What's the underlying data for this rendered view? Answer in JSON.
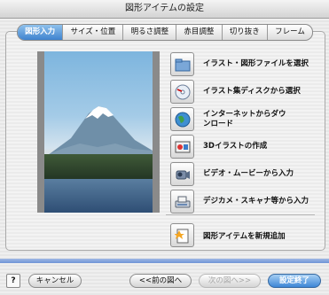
{
  "window": {
    "title": "図形アイテムの設定"
  },
  "tabs": [
    {
      "label": "図形入力"
    },
    {
      "label": "サイズ・位置"
    },
    {
      "label": "明るさ調整"
    },
    {
      "label": "赤目調整"
    },
    {
      "label": "切り抜き"
    },
    {
      "label": "フレーム"
    }
  ],
  "actions": [
    {
      "label": "イラスト・図形ファイルを選択",
      "icon": "folder-icon"
    },
    {
      "label": "イラスト集ディスクから選択",
      "icon": "disc-icon"
    },
    {
      "label_line1": "インターネットからダウ",
      "label_line2": "ンロード",
      "icon": "globe-icon"
    },
    {
      "label": "3Dイラストの作成",
      "icon": "3d-illustration-icon"
    },
    {
      "label": "ビデオ・ムービーから入力",
      "icon": "video-camera-icon"
    },
    {
      "label": "デジカメ・スキャナ等から入力",
      "icon": "scanner-icon"
    }
  ],
  "add_item": {
    "label": "図形アイテムを新規追加",
    "icon": "new-document-icon"
  },
  "footer": {
    "help": "?",
    "cancel": "キャンセル",
    "prev": "<<前の図へ",
    "next": "次の図へ>>",
    "done": "設定終了"
  },
  "colors": {
    "accent": "#3f83cf",
    "stripe": "#6f94d6"
  }
}
